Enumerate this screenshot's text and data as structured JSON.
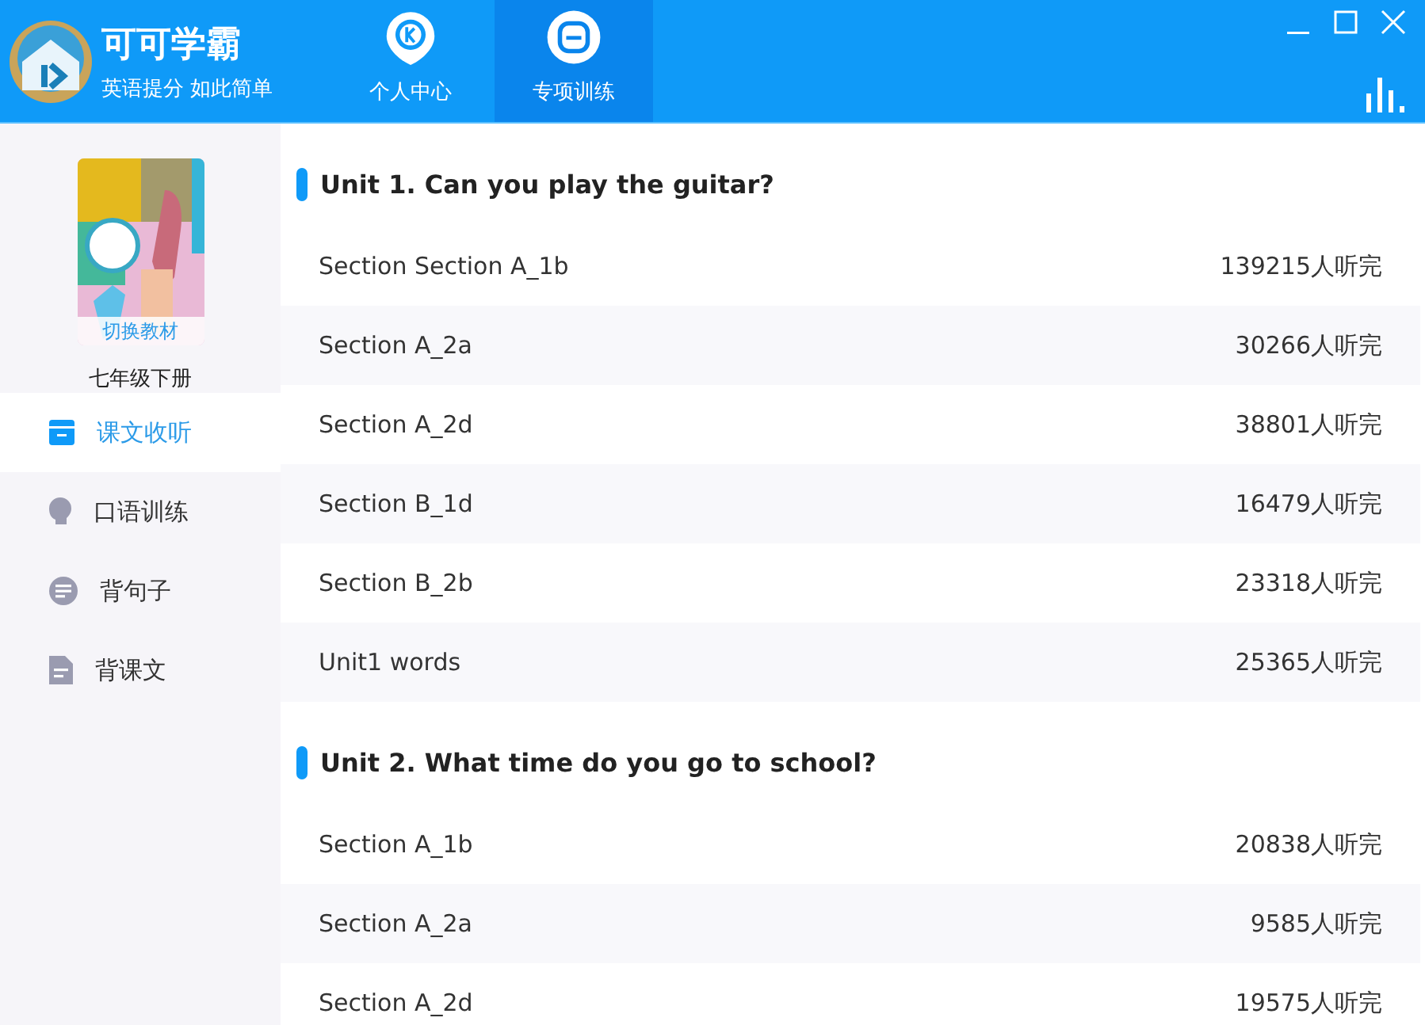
{
  "app": {
    "name": "可可学霸",
    "slogan": "英语提分 如此简单"
  },
  "nav_tabs": [
    {
      "label": "个人中心",
      "kind": "person",
      "selected": false
    },
    {
      "label": "专项训练",
      "kind": "training",
      "selected": true
    }
  ],
  "book": {
    "switch_label": "切换教材",
    "grade": "七年级下册"
  },
  "sidebar": {
    "items": [
      {
        "label": "课文收听",
        "kind": "listen",
        "selected": true
      },
      {
        "label": "口语训练",
        "kind": "speak",
        "selected": false
      },
      {
        "label": "背句子",
        "kind": "sentence",
        "selected": false
      },
      {
        "label": "背课文",
        "kind": "text",
        "selected": false
      }
    ]
  },
  "units": [
    {
      "title": "Unit 1. Can you play the guitar?",
      "lessons": [
        {
          "name": "Section Section A_1b",
          "count": "139215人听完"
        },
        {
          "name": "Section A_2a",
          "count": "30266人听完"
        },
        {
          "name": "Section A_2d",
          "count": "38801人听完"
        },
        {
          "name": "Section B_1d",
          "count": "16479人听完"
        },
        {
          "name": "Section B_2b",
          "count": "23318人听完"
        },
        {
          "name": "Unit1 words",
          "count": "25365人听完"
        }
      ]
    },
    {
      "title": "Unit 2. What time do you go to school?",
      "lessons": [
        {
          "name": "Section A_1b",
          "count": "20838人听完"
        },
        {
          "name": "Section A_2a",
          "count": "9585人听完"
        },
        {
          "name": "Section A_2d",
          "count": "19575人听完"
        }
      ]
    }
  ]
}
